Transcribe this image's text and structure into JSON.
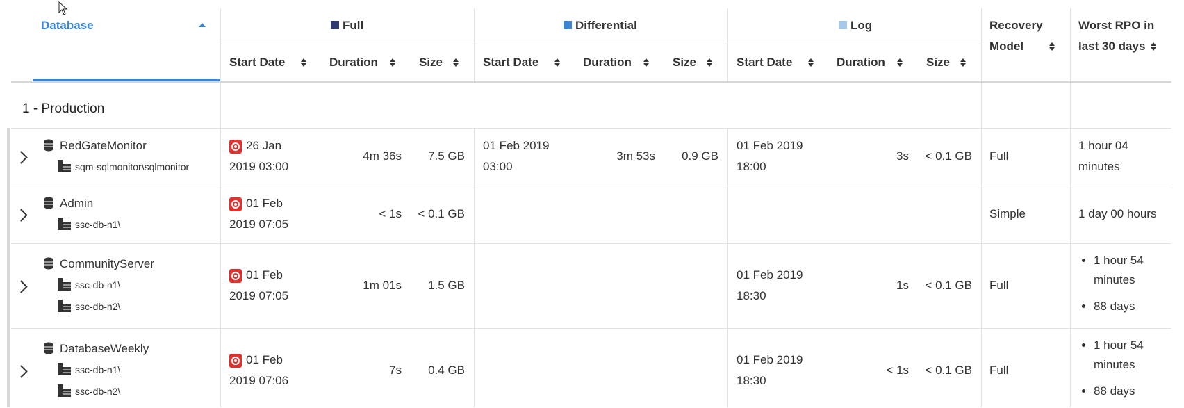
{
  "header": {
    "database": "Database",
    "full": "Full",
    "differential": "Differential",
    "log": "Log",
    "start_date": "Start Date",
    "duration": "Duration",
    "size": "Size",
    "recovery_model_1": "Recovery",
    "recovery_model_2": "Model",
    "worst_rpo_1": "Worst RPO in",
    "worst_rpo_2": "last 30 days"
  },
  "colors": {
    "accent": "#3a86d4",
    "full": "#2d3a6e",
    "differential": "#3a86d4",
    "log": "#a8c8ea"
  },
  "group": {
    "label": "1 - Production"
  },
  "rows": [
    {
      "name": "RedGateMonitor",
      "servers": [
        "sqm-sqlmonitor\\sqlmonitor"
      ],
      "full": {
        "date1": "26 Jan",
        "date2": "2019 03:00",
        "duration": "4m 36s",
        "size": "7.5 GB"
      },
      "diff": {
        "date1": "01 Feb 2019",
        "date2": "03:00",
        "duration": "3m 53s",
        "size": "0.9 GB"
      },
      "log": {
        "date1": "01 Feb 2019",
        "date2": "18:00",
        "duration": "3s",
        "size": "< 0.1 GB"
      },
      "recovery": "Full",
      "rpo": [
        "1 hour 04",
        "minutes"
      ]
    },
    {
      "name": "Admin",
      "servers": [
        "ssc-db-n1\\"
      ],
      "full": {
        "date1": "01 Feb",
        "date2": "2019 07:05",
        "duration": "< 1s",
        "size": "< 0.1 GB"
      },
      "recovery": "Simple",
      "rpo": [
        "1 day 00 hours"
      ]
    },
    {
      "name": "CommunityServer",
      "servers": [
        "ssc-db-n1\\",
        "ssc-db-n2\\"
      ],
      "full": {
        "date1": "01 Feb",
        "date2": "2019 07:05",
        "duration": "1m 01s",
        "size": "1.5 GB"
      },
      "log": {
        "date1": "01 Feb 2019",
        "date2": "18:30",
        "duration": "1s",
        "size": "< 0.1 GB"
      },
      "recovery": "Full",
      "rpo_list": [
        "1 hour 54 minutes",
        "88 days"
      ]
    },
    {
      "name": "DatabaseWeekly",
      "servers": [
        "ssc-db-n1\\",
        "ssc-db-n2\\"
      ],
      "full": {
        "date1": "01 Feb",
        "date2": "2019 07:06",
        "duration": "7s",
        "size": "0.4 GB"
      },
      "log": {
        "date1": "01 Feb 2019",
        "date2": "18:30",
        "duration": "< 1s",
        "size": "< 0.1 GB"
      },
      "recovery": "Full",
      "rpo_list": [
        "1 hour 54 minutes",
        "88 days"
      ]
    }
  ]
}
